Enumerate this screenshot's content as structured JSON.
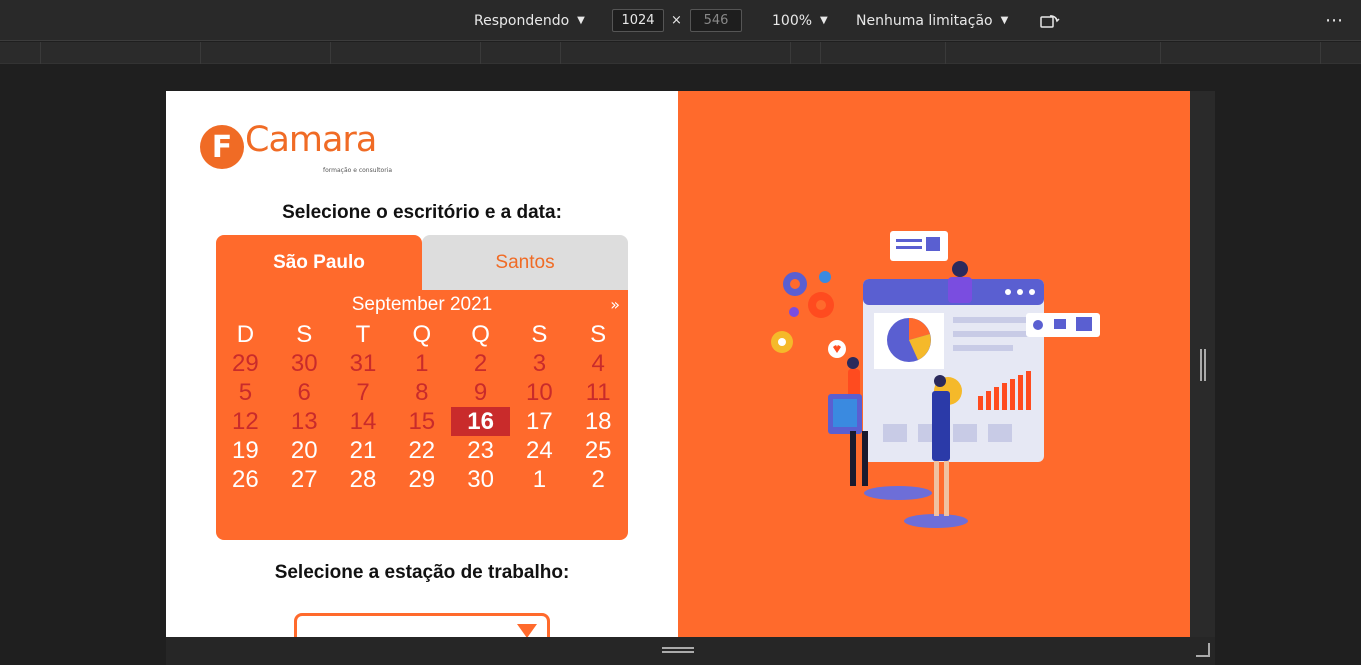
{
  "devtools": {
    "device_mode": "Respondendo",
    "width": "1024",
    "height": "546",
    "zoom": "100%",
    "throttling": "Nenhuma limitação",
    "times": "×",
    "more": "⋯"
  },
  "app": {
    "logo_text": "Camara",
    "logo_letter": "F",
    "logo_sub": "formação e consultoria",
    "office_heading": "Selecione o escritório e a data:",
    "station_heading": "Selecione a estação de trabalho:"
  },
  "tabs": [
    {
      "label": "São Paulo",
      "active": true
    },
    {
      "label": "Santos",
      "active": false
    }
  ],
  "calendar": {
    "month_label": "September 2021",
    "next": "»",
    "weekdays": [
      "D",
      "S",
      "T",
      "Q",
      "Q",
      "S",
      "S"
    ],
    "weeks": [
      [
        "29",
        "30",
        "31",
        "1",
        "2",
        "3",
        "4"
      ],
      [
        "5",
        "6",
        "7",
        "8",
        "9",
        "10",
        "11"
      ],
      [
        "12",
        "13",
        "14",
        "15",
        "16",
        "17",
        "18"
      ],
      [
        "19",
        "20",
        "21",
        "22",
        "23",
        "24",
        "25"
      ],
      [
        "26",
        "27",
        "28",
        "29",
        "30",
        "1",
        "2"
      ]
    ],
    "selected": "16"
  },
  "colors": {
    "accent": "#ff6a2c",
    "selected": "#c92b2b",
    "past": "#c92b2b"
  }
}
